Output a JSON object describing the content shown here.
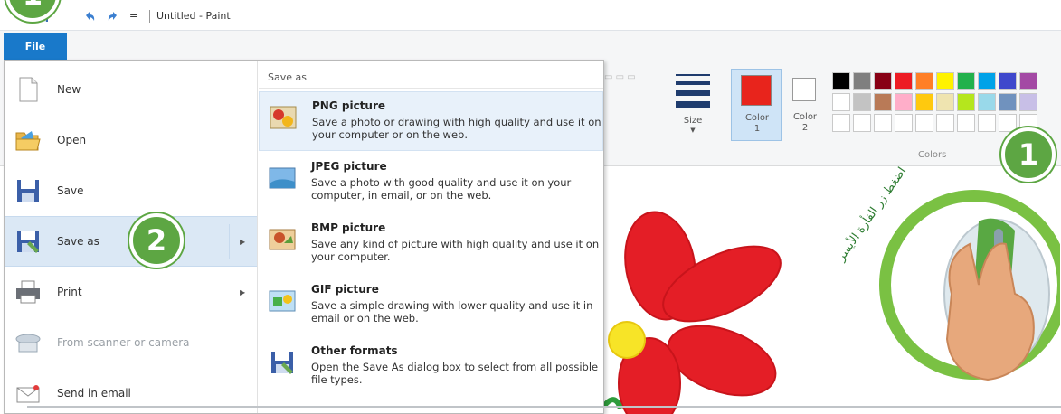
{
  "window": {
    "title": "Untitled - Paint"
  },
  "file_tab": {
    "label": "File"
  },
  "menu": {
    "items": [
      {
        "label": "New",
        "enabled": true
      },
      {
        "label": "Open",
        "enabled": true
      },
      {
        "label": "Save",
        "enabled": true
      },
      {
        "label": "Save as",
        "enabled": true,
        "has_submenu": true,
        "selected": true
      },
      {
        "label": "Print",
        "enabled": true,
        "has_submenu": true
      },
      {
        "label": "From scanner or camera",
        "enabled": false
      },
      {
        "label": "Send in email",
        "enabled": true
      }
    ]
  },
  "submenu": {
    "header": "Save as",
    "items": [
      {
        "title": "PNG picture",
        "description": "Save a photo or drawing with high quality and use it on your computer or on the web."
      },
      {
        "title": "JPEG picture",
        "description": "Save a photo with good quality and use it on your computer, in email, or on the web."
      },
      {
        "title": "BMP picture",
        "description": "Save any kind of picture with high quality and use it on your computer."
      },
      {
        "title": "GIF picture",
        "description": "Save a simple drawing with lower quality and use it in email or on the web."
      },
      {
        "title": "Other formats",
        "description": "Open the Save As dialog box to select from all possible file types."
      }
    ]
  },
  "ribbon": {
    "size_label": "Size",
    "color1_label": "Color",
    "color1_num": "1",
    "color2_label": "Color",
    "color2_num": "2",
    "colors_group_label": "Colors",
    "color1_value": "#e8241c",
    "palette": [
      "#000000",
      "#7f7f7f",
      "#880015",
      "#ed1c24",
      "#ff7f27",
      "#fff200",
      "#22b14c",
      "#00a2e8",
      "#3f48cc",
      "#a349a4",
      "#ffffff",
      "#c3c3c3",
      "#b97a57",
      "#ffaec9",
      "#ffc90e",
      "#efe4b0",
      "#b5e61d",
      "#99d9ea",
      "#7092be",
      "#c8bfe7"
    ]
  },
  "callouts": {
    "badge1": "1",
    "badge2": "2",
    "mouse_caption": "اضغط زر الفأرة الأيسر"
  }
}
